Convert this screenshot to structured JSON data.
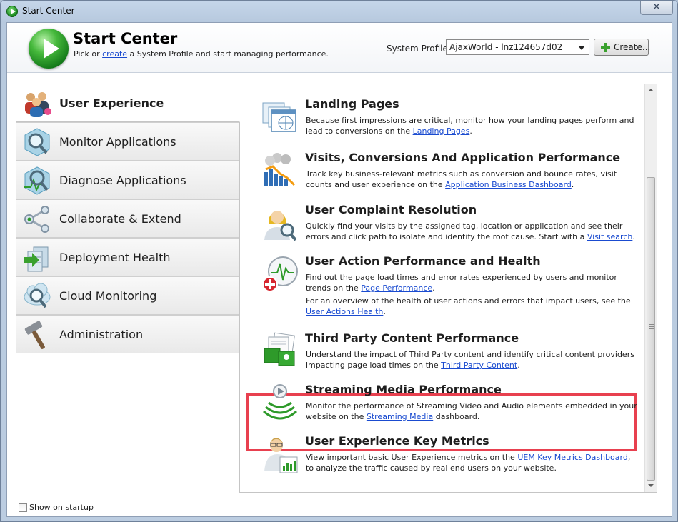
{
  "window": {
    "title": "Start Center",
    "close_glyph": "✕"
  },
  "header": {
    "title": "Start Center",
    "subtitle_pre": "Pick or ",
    "subtitle_link": "create",
    "subtitle_post": " a System Profile and start managing performance.",
    "profile_label": "System Profile:",
    "profile_value": "AjaxWorld - lnz124657d02",
    "create_label": "Create..."
  },
  "nav": {
    "items": [
      {
        "label": "User Experience",
        "icon": "users-icon",
        "active": true
      },
      {
        "label": "Monitor Applications",
        "icon": "monitor-magnifier-icon"
      },
      {
        "label": "Diagnose Applications",
        "icon": "diagnose-magnifier-icon"
      },
      {
        "label": "Collaborate & Extend",
        "icon": "share-icon"
      },
      {
        "label": "Deployment Health",
        "icon": "servers-icon"
      },
      {
        "label": "Cloud Monitoring",
        "icon": "cloud-magnifier-icon"
      },
      {
        "label": "Administration",
        "icon": "hammer-icon"
      }
    ]
  },
  "sections": [
    {
      "title": "Landing Pages",
      "icon": "landing-pages-icon",
      "desc": [
        {
          "pre": "Because first impressions are critical, monitor how your landing pages perform and lead to conversions on the ",
          "link": "Landing Pages",
          "post": "."
        }
      ]
    },
    {
      "title": "Visits, Conversions And Application Performance",
      "icon": "visits-chart-icon",
      "desc": [
        {
          "pre": "Track key business-relevant metrics such as conversion and bounce rates, visit counts and user experience on the ",
          "link": "Application Business Dashboard",
          "post": "."
        }
      ]
    },
    {
      "title": "User Complaint Resolution",
      "icon": "support-agent-icon",
      "desc": [
        {
          "pre": "Quickly find your visits by the assigned tag, location or application and see their errors and click path to isolate and identify the root cause. Start with a ",
          "link": "Visit search",
          "post": "."
        }
      ]
    },
    {
      "title": "User Action Performance and Health",
      "icon": "heartbeat-icon",
      "desc": [
        {
          "pre": "Find out the page load times and error rates experienced by users and monitor trends on the ",
          "link": "Page Performance",
          "post": "."
        },
        {
          "pre": "For an overview of the health of user actions and errors that impact users, see the ",
          "link": "User Actions Health",
          "post": "."
        }
      ]
    },
    {
      "title": "Third Party Content Performance",
      "icon": "third-party-content-icon",
      "desc": [
        {
          "pre": "Understand the impact of Third Party content and identify critical content providers impacting page load times on the ",
          "link": "Third Party Content",
          "post": "."
        }
      ]
    },
    {
      "title": "Streaming Media Performance",
      "icon": "streaming-media-icon",
      "desc": [
        {
          "pre": "Monitor the performance of Streaming Video and Audio elements embedded in your website on the ",
          "link": "Streaming Media",
          "post": " dashboard."
        }
      ]
    },
    {
      "title": "User Experience Key Metrics",
      "icon": "key-metrics-icon",
      "desc": [
        {
          "pre": "View important basic User Experience metrics on the ",
          "link": "UEM Key Metrics Dashboard",
          "post": ", to analyze the traffic caused by real end users on your website."
        }
      ]
    }
  ],
  "footer": {
    "show_on_startup": "Show on startup",
    "checked": false
  },
  "colors": {
    "highlight": "#e8404f",
    "link": "#1a4bd0",
    "accent_green": "#2e9a2a"
  }
}
